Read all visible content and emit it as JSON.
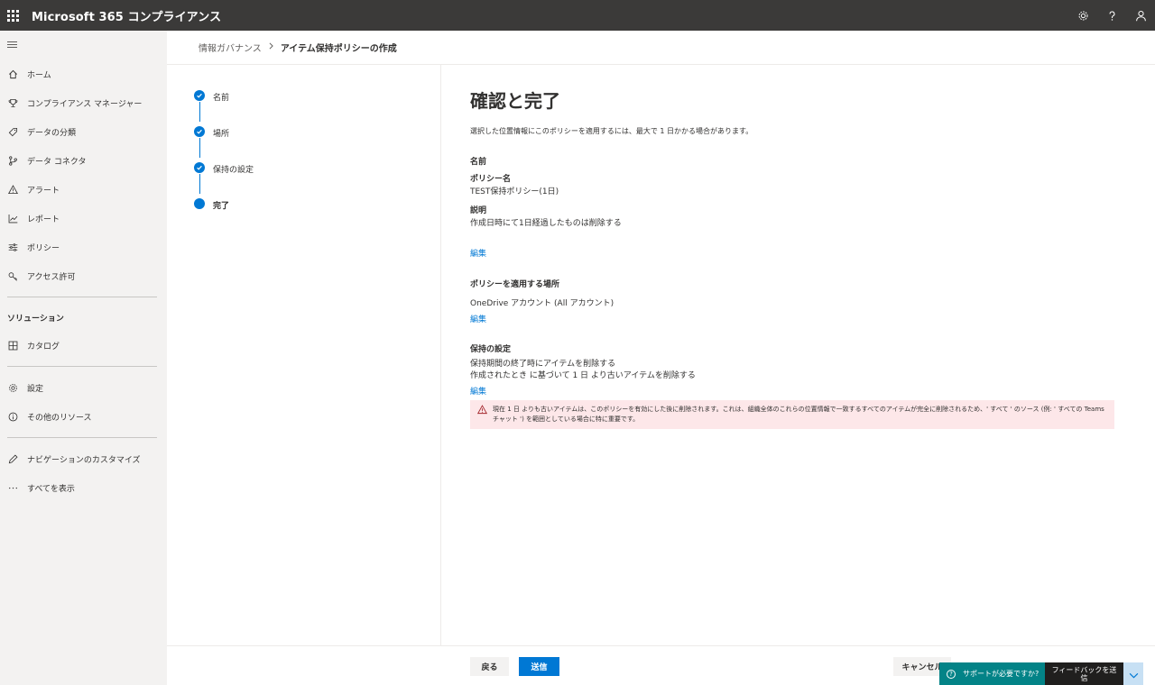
{
  "app": {
    "title": "Microsoft 365 コンプライアンス"
  },
  "topbar": {
    "icons": [
      "settings-icon",
      "help-icon",
      "user-icon"
    ]
  },
  "nav": {
    "items": [
      {
        "label": "ホーム",
        "icon": "home-icon"
      },
      {
        "label": "コンプライアンス マネージャー",
        "icon": "trophy-icon"
      },
      {
        "label": "データの分類",
        "icon": "tag-icon"
      },
      {
        "label": "データ コネクタ",
        "icon": "connector-icon"
      },
      {
        "label": "アラート",
        "icon": "alert-icon"
      },
      {
        "label": "レポート",
        "icon": "chart-icon"
      },
      {
        "label": "ポリシー",
        "icon": "policy-icon"
      },
      {
        "label": "アクセス許可",
        "icon": "key-icon"
      }
    ],
    "solutions_heading": "ソリューション",
    "catalog": "カタログ",
    "settings": "設定",
    "more_resources": "その他のリソース",
    "customize": "ナビゲーションのカスタマイズ",
    "show_all": "すべてを表示"
  },
  "breadcrumb": {
    "parent": "情報ガバナンス",
    "current": "アイテム保持ポリシーの作成"
  },
  "steps": [
    {
      "label": "名前",
      "state": "completed"
    },
    {
      "label": "場所",
      "state": "completed"
    },
    {
      "label": "保持の設定",
      "state": "completed"
    },
    {
      "label": "完了",
      "state": "current"
    }
  ],
  "main": {
    "title": "確認と完了",
    "intro": "選択した位置情報にこのポリシーを適用するには、最大で 1 日かかる場合があります。",
    "name_section": {
      "heading": "名前",
      "policy_name_label": "ポリシー名",
      "policy_name_value": "TEST保持ポリシー(1日)",
      "description_label": "説明",
      "description_value": "作成日時にて1日経過したものは削除する",
      "edit": "編集"
    },
    "locations_section": {
      "heading": "ポリシーを適用する場所",
      "value": "OneDrive アカウント (All アカウント)",
      "edit": "編集"
    },
    "retention_section": {
      "heading": "保持の設定",
      "line1": "保持期間の終了時にアイテムを削除する",
      "line2": "作成されたとき に基づいて 1 日 より古いアイテムを削除する",
      "edit": "編集"
    },
    "warning": "現在 1 日 よりも古いアイテムは、このポリシーを有効にした後に削除されます。これは、組織全体のこれらの位置情報で一致するすべてのアイテムが完全に削除されるため、' すべて ' のソース (例: ' すべての Teams チャット ') を範囲としている場合に特に重要です。"
  },
  "footer": {
    "back": "戻る",
    "submit": "送信",
    "cancel": "キャンセル",
    "support": "サポートが必要ですか?",
    "feedback": "フィードバックを送信"
  },
  "colors": {
    "accent": "#0078d4",
    "topbar": "#3b3a39",
    "warning_bg": "#fde7e9",
    "support": "#038387"
  }
}
